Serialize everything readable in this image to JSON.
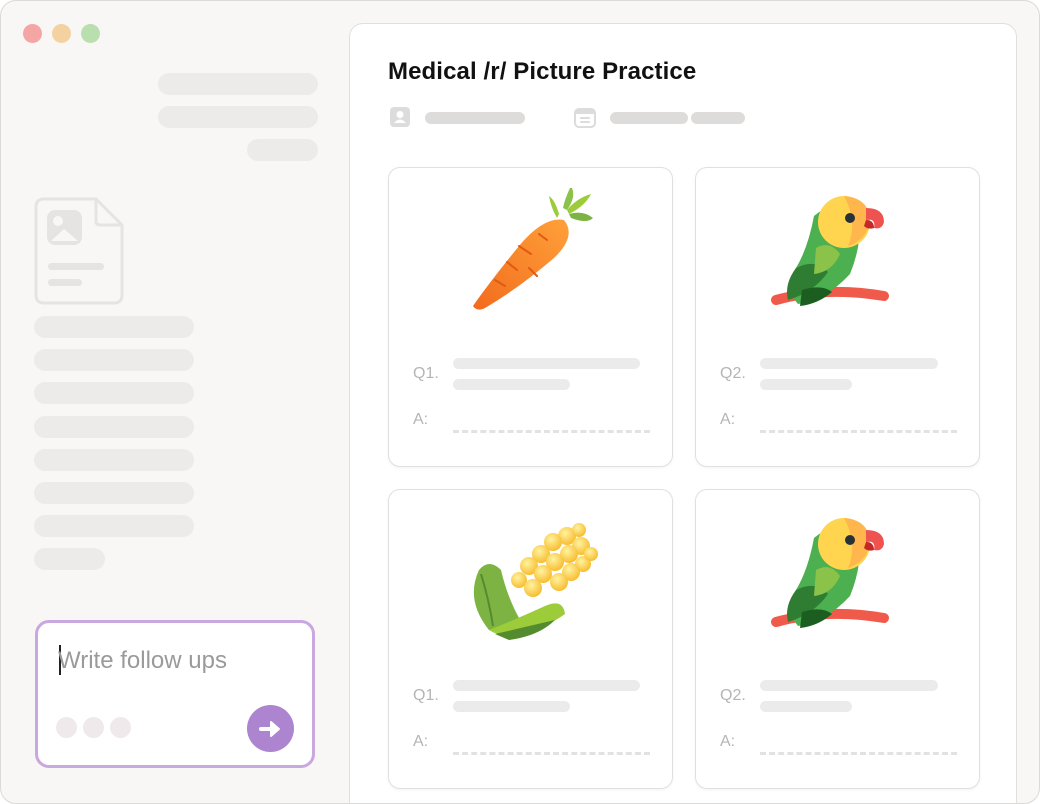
{
  "window": {
    "title": "Medical /r/ Picture Practice",
    "traffic_lights": [
      "#f4a6a4",
      "#f4d2a0",
      "#b9dfae"
    ]
  },
  "compose": {
    "placeholder": "Write follow ups",
    "send_icon": "arrow-right-icon",
    "accent": "#ad84cf"
  },
  "cards": [
    {
      "image": "carrot",
      "question_label": "Q1.",
      "answer_label": "A:"
    },
    {
      "image": "parrot",
      "question_label": "Q2.",
      "answer_label": "A:"
    },
    {
      "image": "corn",
      "question_label": "Q1.",
      "answer_label": "A:"
    },
    {
      "image": "parrot",
      "question_label": "Q2.",
      "answer_label": "A:"
    }
  ]
}
